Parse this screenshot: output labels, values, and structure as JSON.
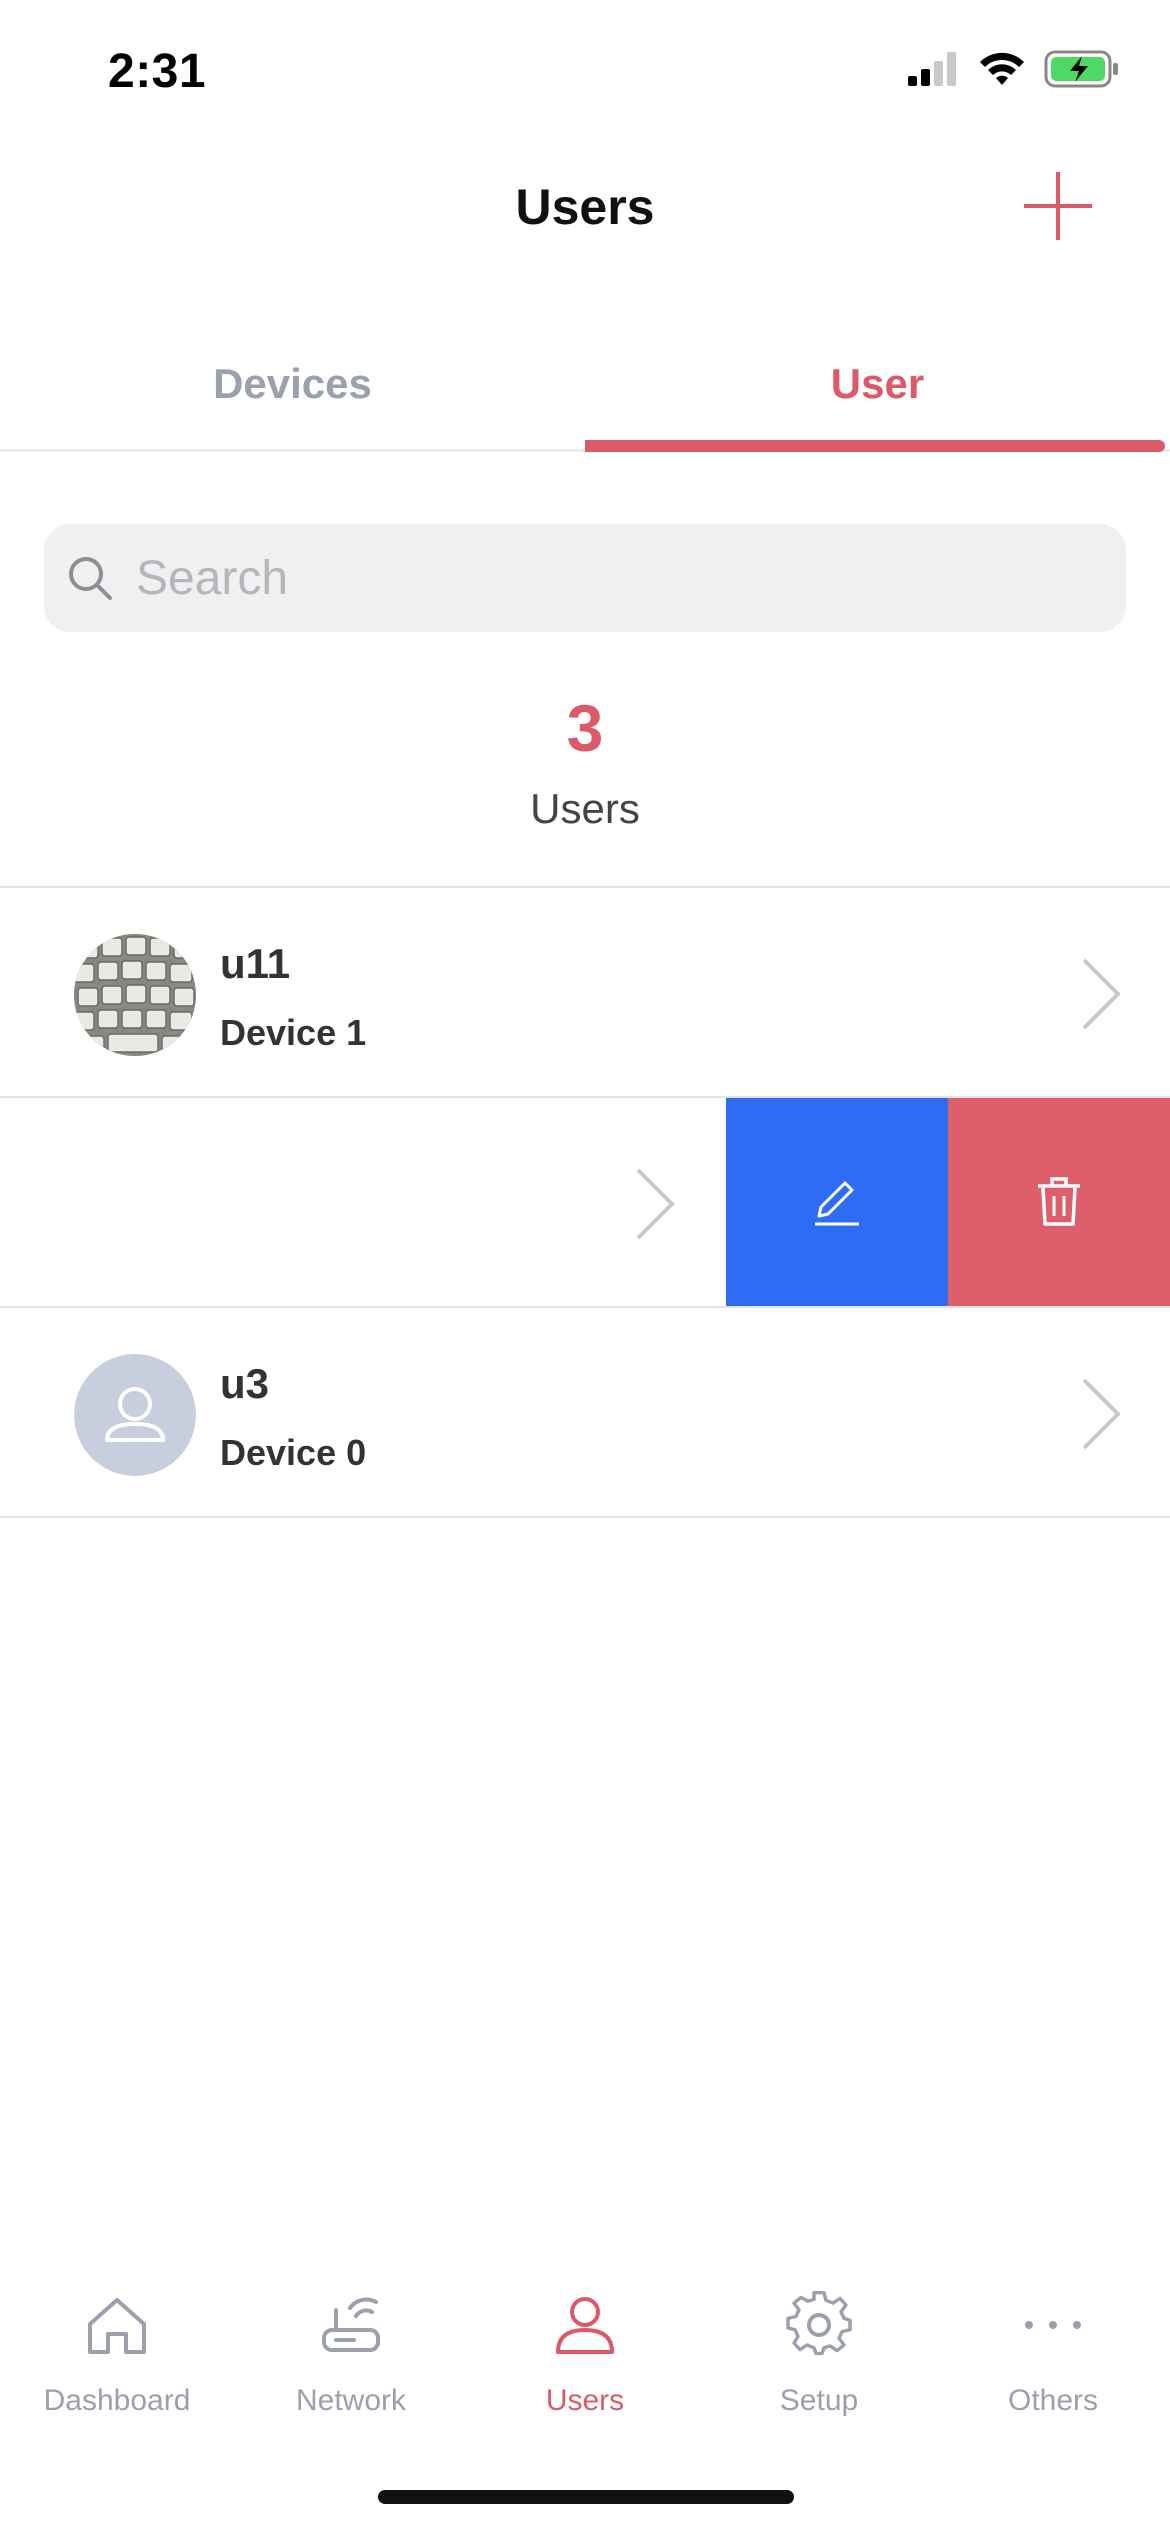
{
  "status_bar": {
    "time": "2:31",
    "signal_icon": "cellular-signal-icon",
    "wifi_icon": "wifi-icon",
    "battery_icon": "battery-charging-icon"
  },
  "header": {
    "title": "Users",
    "add_icon": "plus-icon"
  },
  "tabs": [
    {
      "label": "Devices",
      "active": false
    },
    {
      "label": "User",
      "active": true
    }
  ],
  "search": {
    "placeholder": "Search",
    "value": "",
    "icon": "search-icon"
  },
  "summary": {
    "count": "3",
    "label": "Users"
  },
  "users": [
    {
      "name": "u11",
      "devices": "Device 1",
      "avatar": "photo-keyboard"
    },
    {
      "name": "",
      "devices": "",
      "swiped": true,
      "actions": [
        "edit-icon",
        "trash-icon"
      ]
    },
    {
      "name": "u3",
      "devices": "Device 0",
      "avatar": "default-person-icon"
    }
  ],
  "bottom_nav": [
    {
      "label": "Dashboard",
      "icon": "home-icon",
      "active": false
    },
    {
      "label": "Network",
      "icon": "router-icon",
      "active": false
    },
    {
      "label": "Users",
      "icon": "person-icon",
      "active": true
    },
    {
      "label": "Setup",
      "icon": "gear-icon",
      "active": false
    },
    {
      "label": "Others",
      "icon": "more-dots-icon",
      "active": false
    }
  ],
  "colors": {
    "accent": "#dc5a68",
    "edit": "#2f6cf6",
    "delete": "#df5e6b",
    "inactive": "#9aa0ac"
  }
}
